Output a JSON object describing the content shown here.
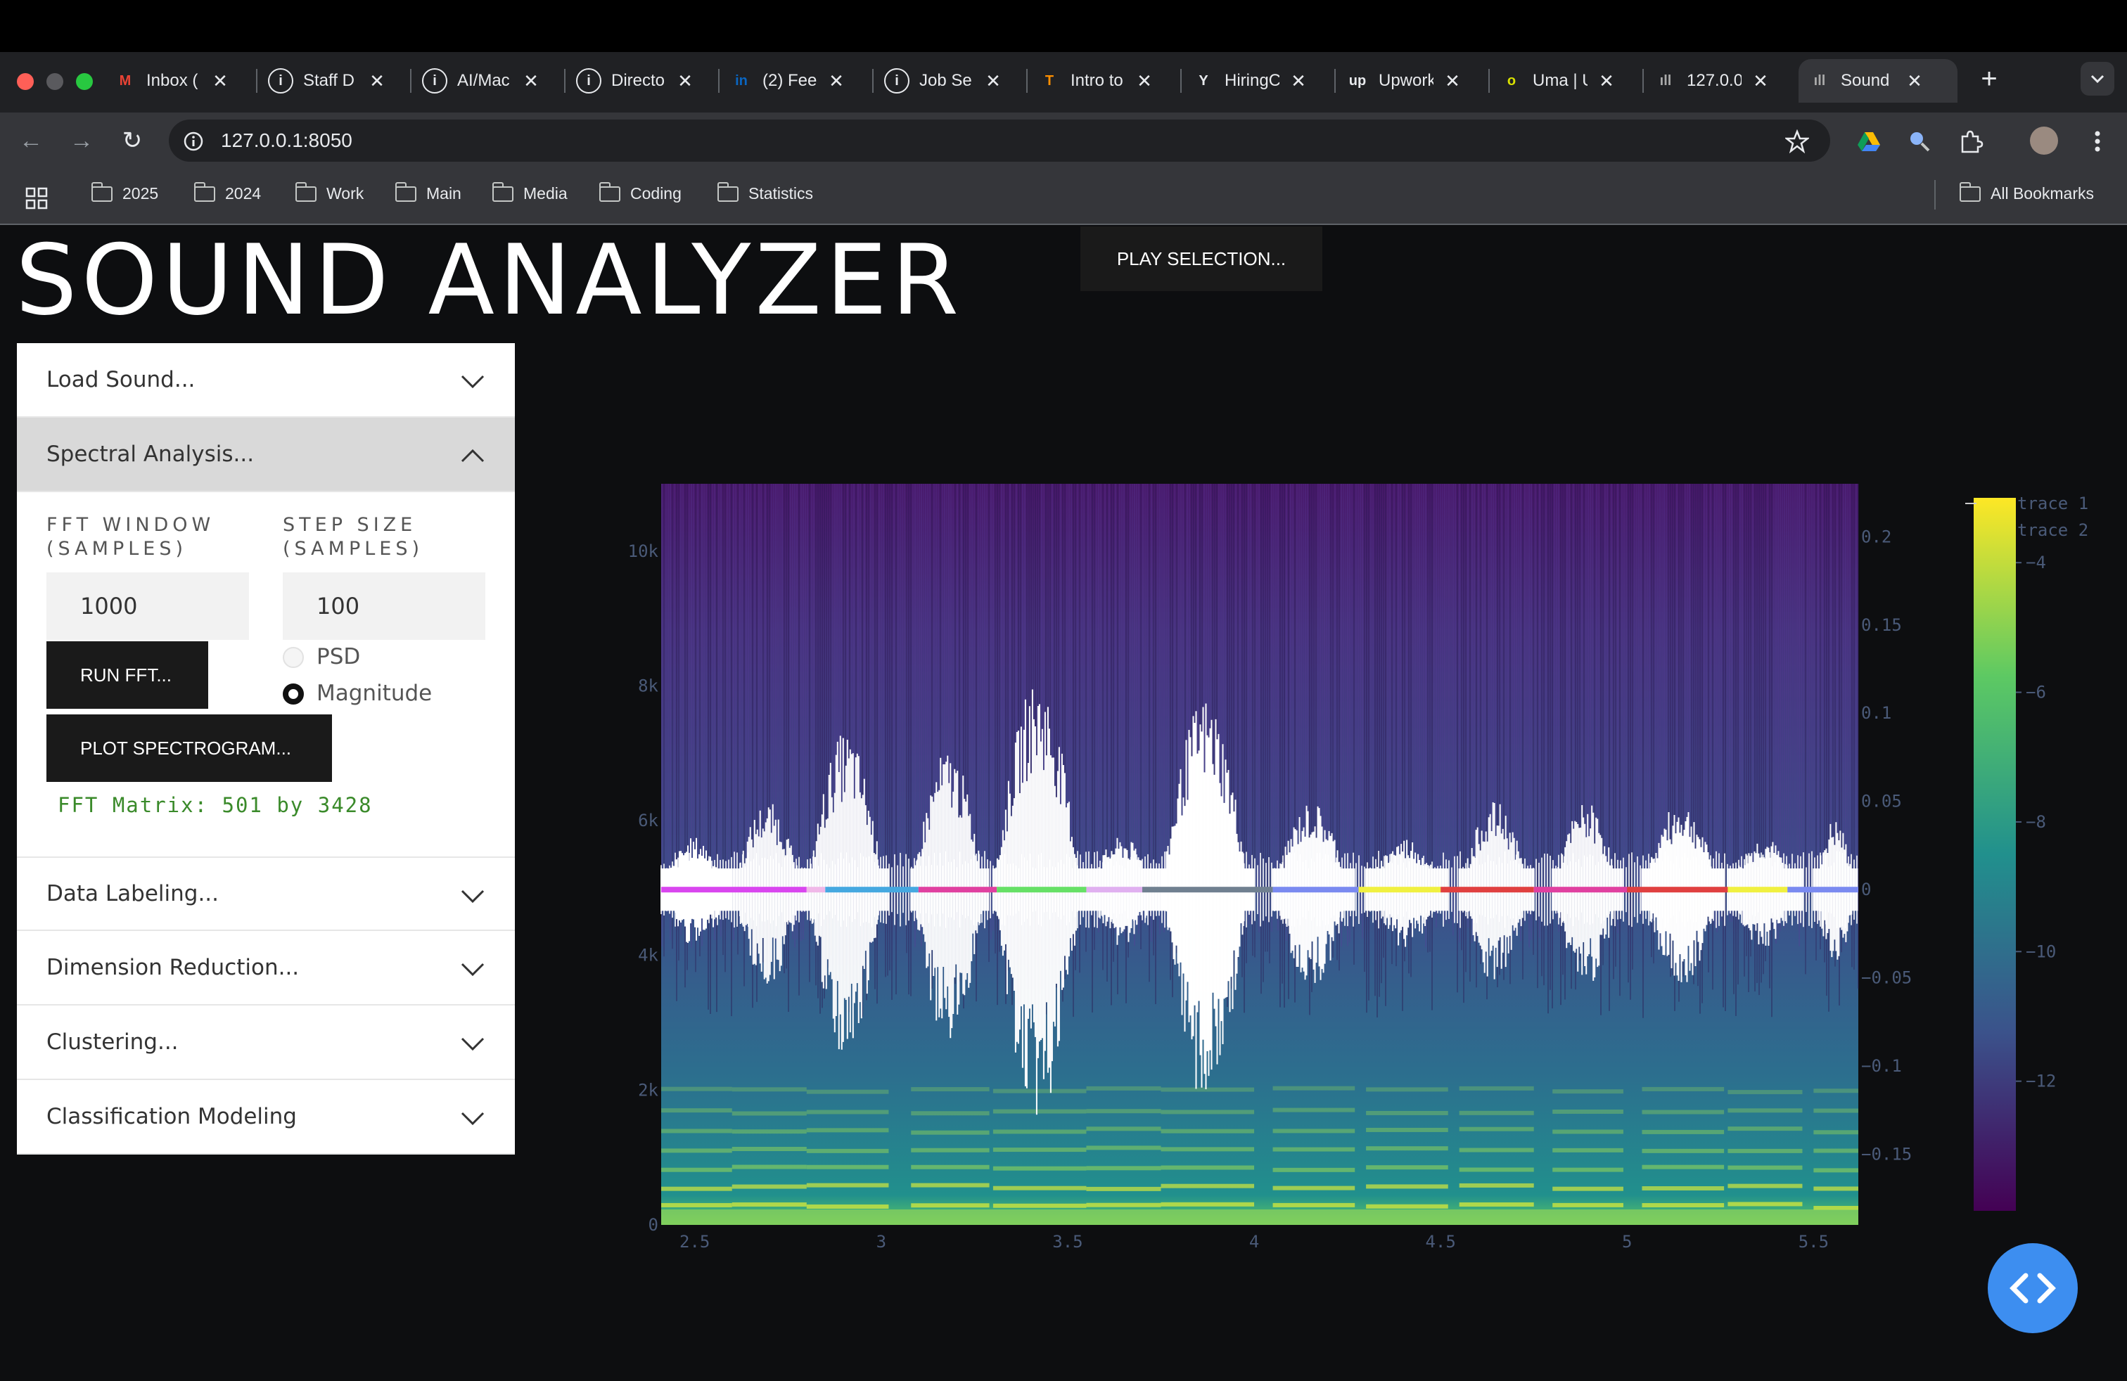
{
  "browser": {
    "tabs": [
      {
        "label": "Inbox (",
        "icon": "gmail-icon",
        "color": "#ea4335",
        "glyph": "M"
      },
      {
        "label": "Staff D",
        "icon": "info-icon",
        "color": "#e8eaed",
        "glyph": "i"
      },
      {
        "label": "AI/Mac",
        "icon": "info-icon",
        "color": "#e8eaed",
        "glyph": "i"
      },
      {
        "label": "Directo",
        "icon": "info-icon",
        "color": "#e8eaed",
        "glyph": "i"
      },
      {
        "label": "(2) Fee",
        "icon": "linkedin-icon",
        "color": "#0a66c2",
        "glyph": "in"
      },
      {
        "label": "Job Se",
        "icon": "info-icon",
        "color": "#e8eaed",
        "glyph": "i"
      },
      {
        "label": "Intro to",
        "icon": "tensorflow-icon",
        "color": "#ff8f00",
        "glyph": "T"
      },
      {
        "label": "HiringC",
        "icon": "ycombinator-icon",
        "color": "#e8eaed",
        "glyph": "Y"
      },
      {
        "label": "Upwork",
        "icon": "upwork-icon",
        "color": "#e8eaed",
        "glyph": "up"
      },
      {
        "label": "Uma | U",
        "icon": "uma-icon",
        "color": "#d8e000",
        "glyph": "o"
      },
      {
        "label": "127.0.0",
        "icon": "bars-icon",
        "color": "#aaaaaa",
        "glyph": "ıll"
      },
      {
        "label": "Sound",
        "icon": "bars-icon",
        "color": "#aaaaaa",
        "glyph": "ıll"
      }
    ],
    "url": "127.0.0.1:8050",
    "bookmarks": [
      "2025",
      "2024",
      "Work",
      "Main",
      "Media",
      "Coding",
      "Statistics"
    ],
    "all_bookmarks": "All Bookmarks",
    "new_tab": "+",
    "close_glyph": "✕"
  },
  "app": {
    "title": "SOUND ANALYZER",
    "play_button": "PLAY SELECTION...",
    "sections": {
      "load": "Load Sound...",
      "spectral": "Spectral Analysis...",
      "labeling": "Data Labeling...",
      "dimred": "Dimension Reduction...",
      "clustering": "Clustering...",
      "classification": "Classification Modeling"
    },
    "fft_window_label": "FFT WINDOW (SAMPLES)",
    "step_size_label": "STEP SIZE (SAMPLES)",
    "fft_window_value": "1000",
    "step_size_value": "100",
    "run_fft": "RUN FFT...",
    "plot_spectrogram": "PLOT SPECTROGRAM...",
    "radio_options": [
      "PSD",
      "Magnitude"
    ],
    "radio_selected": "Magnitude",
    "fft_matrix": "FFT Matrix: 501 by 3428"
  },
  "chart_data": {
    "type": "heatmap",
    "x_ticks": [
      "2.5",
      "3",
      "3.5",
      "4",
      "4.5",
      "5",
      "5.5"
    ],
    "xlim": [
      2.41,
      5.62
    ],
    "y_ticks": [
      "0",
      "2k",
      "4k",
      "6k",
      "8k",
      "10k"
    ],
    "ylim": [
      0,
      11000
    ],
    "y2_ticks": [
      "0.2",
      "0.15",
      "0.1",
      "0.05",
      "0",
      "−0.05",
      "−0.1",
      "−0.15"
    ],
    "y2lim": [
      -0.19,
      0.23
    ],
    "colorbar_ticks": [
      "−4",
      "−6",
      "−8",
      "−10",
      "−12"
    ],
    "colorbar_range": [
      -14,
      -3
    ],
    "legend": [
      "trace 1",
      "trace 2"
    ],
    "colormap": [
      "#440154",
      "#3b528b",
      "#21908d",
      "#5dc963",
      "#fde725"
    ],
    "label_segments": [
      {
        "start": 2.41,
        "end": 2.8,
        "color": "#d946ef"
      },
      {
        "start": 2.8,
        "end": 2.85,
        "color": "#f0b8e8"
      },
      {
        "start": 2.85,
        "end": 3.1,
        "color": "#45a8e0"
      },
      {
        "start": 3.1,
        "end": 3.31,
        "color": "#e040a0"
      },
      {
        "start": 3.31,
        "end": 3.55,
        "color": "#66e066"
      },
      {
        "start": 3.55,
        "end": 3.7,
        "color": "#e0b0f0"
      },
      {
        "start": 3.7,
        "end": 4.05,
        "color": "#708090"
      },
      {
        "start": 4.05,
        "end": 4.28,
        "color": "#7a8af0"
      },
      {
        "start": 4.28,
        "end": 4.5,
        "color": "#f0f040"
      },
      {
        "start": 4.5,
        "end": 4.75,
        "color": "#e04040"
      },
      {
        "start": 4.75,
        "end": 5.0,
        "color": "#e040a0"
      },
      {
        "start": 5.0,
        "end": 5.27,
        "color": "#e04040"
      },
      {
        "start": 5.27,
        "end": 5.43,
        "color": "#f0f040"
      },
      {
        "start": 5.43,
        "end": 5.62,
        "color": "#7a8af0"
      }
    ],
    "waveform_envelope": [
      {
        "start": 2.41,
        "end": 2.6,
        "peak": 0.03
      },
      {
        "start": 2.6,
        "end": 2.8,
        "peak": 0.05
      },
      {
        "start": 2.8,
        "end": 3.02,
        "peak": 0.09
      },
      {
        "start": 3.08,
        "end": 3.29,
        "peak": 0.08
      },
      {
        "start": 3.3,
        "end": 3.55,
        "peak": 0.12
      },
      {
        "start": 3.55,
        "end": 3.75,
        "peak": 0.03
      },
      {
        "start": 3.75,
        "end": 4.0,
        "peak": 0.11
      },
      {
        "start": 4.05,
        "end": 4.27,
        "peak": 0.05
      },
      {
        "start": 4.3,
        "end": 4.52,
        "peak": 0.03
      },
      {
        "start": 4.55,
        "end": 4.75,
        "peak": 0.05
      },
      {
        "start": 4.8,
        "end": 4.99,
        "peak": 0.05
      },
      {
        "start": 5.04,
        "end": 5.26,
        "peak": 0.05
      },
      {
        "start": 5.27,
        "end": 5.47,
        "peak": 0.03
      },
      {
        "start": 5.5,
        "end": 5.62,
        "peak": 0.04
      }
    ],
    "harmonic_bands_hz": [
      280,
      560,
      840,
      1120,
      1400,
      1680,
      2000
    ]
  }
}
